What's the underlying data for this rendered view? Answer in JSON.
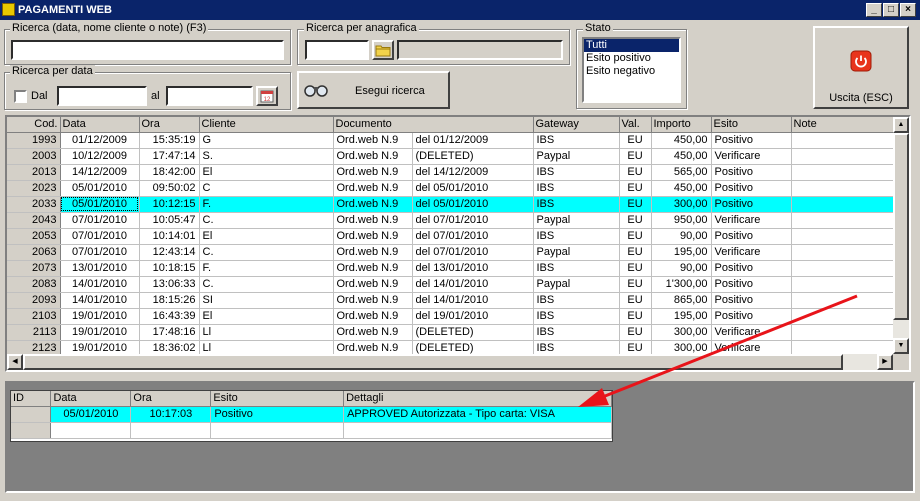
{
  "window": {
    "title": "PAGAMENTI WEB",
    "minimize": "_",
    "maximize": "□",
    "close": "×"
  },
  "search": {
    "label": "Ricerca (data, nome cliente o note) (F3)",
    "value": ""
  },
  "anagrafica": {
    "label": "Ricerca per anagrafica",
    "value": "",
    "name_value": ""
  },
  "stato": {
    "label": "Stato",
    "options": [
      "Tutti",
      "Esito positivo",
      "Esito negativo"
    ],
    "selected": "Tutti"
  },
  "exit_button": {
    "label": "Uscita (ESC)"
  },
  "date_search": {
    "label": "Ricerca per data",
    "from_label": "Dal",
    "to_label": "al",
    "from_value": "",
    "to_value": ""
  },
  "run_search_button": {
    "label": "Esegui ricerca"
  },
  "main_table": {
    "columns": [
      "Cod.",
      "Data",
      "Ora",
      "Cliente",
      "Documento",
      "",
      "Gateway",
      "Val.",
      "Importo",
      "Esito",
      "Note"
    ],
    "rows": [
      [
        "1993",
        "01/12/2009",
        "15:35:19",
        "G",
        "Ord.web N.9",
        "del 01/12/2009",
        "IBS",
        "EU",
        "450,00",
        "Positivo",
        ""
      ],
      [
        "2003",
        "10/12/2009",
        "17:47:14",
        "S.",
        "Ord.web N.9",
        "(DELETED)",
        "Paypal",
        "EU",
        "450,00",
        "Verificare",
        ""
      ],
      [
        "2013",
        "14/12/2009",
        "18:42:00",
        "El",
        "Ord.web N.9",
        "del 14/12/2009",
        "IBS",
        "EU",
        "565,00",
        "Positivo",
        ""
      ],
      [
        "2023",
        "05/01/2010",
        "09:50:02",
        "C",
        "Ord.web N.9",
        "del 05/01/2010",
        "IBS",
        "EU",
        "450,00",
        "Positivo",
        ""
      ],
      [
        "2033",
        "05/01/2010",
        "10:12:15",
        "F.",
        "Ord.web N.9",
        "del 05/01/2010",
        "IBS",
        "EU",
        "300,00",
        "Positivo",
        ""
      ],
      [
        "2043",
        "07/01/2010",
        "10:05:47",
        "C.",
        "Ord.web N.9",
        "del 07/01/2010",
        "Paypal",
        "EU",
        "950,00",
        "Verificare",
        ""
      ],
      [
        "2053",
        "07/01/2010",
        "10:14:01",
        "El",
        "Ord.web N.9",
        "del 07/01/2010",
        "IBS",
        "EU",
        "90,00",
        "Positivo",
        ""
      ],
      [
        "2063",
        "07/01/2010",
        "12:43:14",
        "C.",
        "Ord.web N.9",
        "del 07/01/2010",
        "Paypal",
        "EU",
        "195,00",
        "Verificare",
        ""
      ],
      [
        "2073",
        "13/01/2010",
        "10:18:15",
        "F.",
        "Ord.web N.9",
        "del 13/01/2010",
        "IBS",
        "EU",
        "90,00",
        "Positivo",
        ""
      ],
      [
        "2083",
        "14/01/2010",
        "13:06:33",
        "C.",
        "Ord.web N.9",
        "del 14/01/2010",
        "Paypal",
        "EU",
        "1'300,00",
        "Positivo",
        ""
      ],
      [
        "2093",
        "14/01/2010",
        "18:15:26",
        "SI",
        "Ord.web N.9",
        "del 14/01/2010",
        "IBS",
        "EU",
        "865,00",
        "Positivo",
        ""
      ],
      [
        "2103",
        "19/01/2010",
        "16:43:39",
        "El",
        "Ord.web N.9",
        "del 19/01/2010",
        "IBS",
        "EU",
        "195,00",
        "Positivo",
        ""
      ],
      [
        "2113",
        "19/01/2010",
        "17:48:16",
        "Ll",
        "Ord.web N.9",
        "(DELETED)",
        "IBS",
        "EU",
        "300,00",
        "Verificare",
        ""
      ],
      [
        "2123",
        "19/01/2010",
        "18:36:02",
        "Ll",
        "Ord.web N.9",
        "(DELETED)",
        "IBS",
        "EU",
        "300,00",
        "Verificare",
        ""
      ]
    ],
    "selected_row": 4
  },
  "detail_table": {
    "columns": [
      "ID",
      "Data",
      "Ora",
      "Esito",
      "Dettagli"
    ],
    "rows": [
      [
        "",
        "05/01/2010",
        "10:17:03",
        "Positivo",
        "APPROVED Autorizzata - Tipo carta: VISA"
      ],
      [
        "",
        "",
        "",
        "",
        ""
      ]
    ]
  },
  "colors": {
    "selection": "#00ffff",
    "titlebar": "#0a246a",
    "annotation_arrow": "#e8141a",
    "power_button": "#e8341c"
  },
  "icons": [
    "folder-icon",
    "calendar-icon",
    "binoculars-icon",
    "power-icon"
  ]
}
